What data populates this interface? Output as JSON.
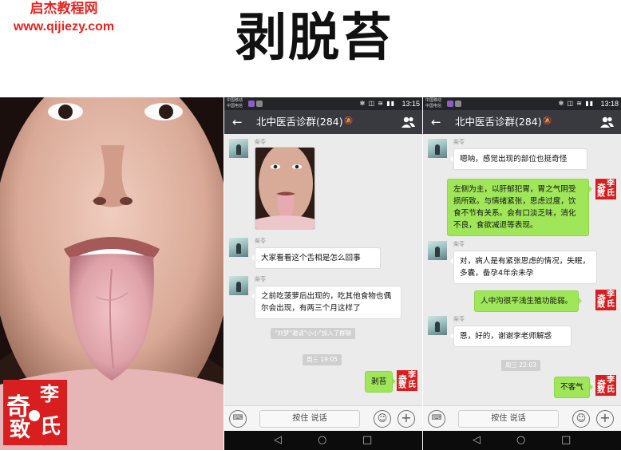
{
  "watermark": {
    "line1": "启杰教程网",
    "line2": "www.qijiezy.com"
  },
  "title": "剥脱苔",
  "seal": {
    "chars": [
      "奇",
      "李",
      "致",
      "氏"
    ]
  },
  "colors": {
    "wechat_green": "#9fe658",
    "nav_bg": "#393a3f",
    "seal_red": "#d81e1e",
    "watermark_red": "#e8231f"
  },
  "phones": [
    {
      "status": {
        "carrier_top": "中国移动",
        "carrier_bottom": "中国电信",
        "icons": "✻ ◫ ≋ ▮▮",
        "time": "13:15"
      },
      "nav": {
        "back": "←",
        "title": "北中医舌诊群(284)",
        "mute": "🔕",
        "group_icon": "people-icon"
      },
      "messages": [
        {
          "id": "m1",
          "nick": "柴苓"
        },
        {
          "id": "m2",
          "nick": "柴苓",
          "text": "大家看看这个舌相是怎么回事"
        },
        {
          "id": "m3",
          "nick": "柴苓",
          "text": "之前吃菠萝后出现的，吃其他食物也偶尔会出现，有两三个月这样了"
        },
        {
          "id": "sys1",
          "text": "\"刘梦\"邀请\"小小\"加入了群聊"
        },
        {
          "id": "time1",
          "text": "周三 19:05"
        },
        {
          "id": "m4",
          "text": "剥苔"
        }
      ],
      "input": {
        "hold_to_talk": "按住 说话",
        "keyboard": "⌨",
        "emoji": "☺",
        "plus": "+"
      },
      "sysnav": {
        "back": "◁",
        "home": "○",
        "recent": "□"
      }
    },
    {
      "status": {
        "carrier_top": "中国移动",
        "carrier_bottom": "中国电信",
        "icons": "✻ ◫ ≋ ▮▮",
        "time": "13:18"
      },
      "nav": {
        "back": "←",
        "title": "北中医舌诊群(284)",
        "mute": "🔕",
        "group_icon": "people-icon"
      },
      "messages": [
        {
          "id": "n1",
          "nick": "柴苓",
          "text": "嗯呐，感觉出现的部位也挺奇怪"
        },
        {
          "id": "n2",
          "text": "左侧为主，以肝郁犯胃，胃之气阴受损所致。与情绪紧张，思虑过度，饮食不节有关系。会有口淡乏味，消化不良，食欲减退等表现。"
        },
        {
          "id": "n3",
          "nick": "柴苓",
          "text": "对，病人是有紧张思虑的情况，失眠，多囊，备孕4年余未孕"
        },
        {
          "id": "n4",
          "text": "人中沟很平浅生殖功能弱。"
        },
        {
          "id": "n5",
          "nick": "柴苓",
          "text": "恩，好的，谢谢李老师解惑"
        },
        {
          "id": "time2",
          "text": "周三 22:03"
        },
        {
          "id": "n6",
          "text": "不客气"
        }
      ],
      "input": {
        "hold_to_talk": "按住 说话",
        "keyboard": "⌨",
        "emoji": "☺",
        "plus": "+"
      },
      "sysnav": {
        "back": "◁",
        "home": "○",
        "recent": "□"
      }
    }
  ]
}
